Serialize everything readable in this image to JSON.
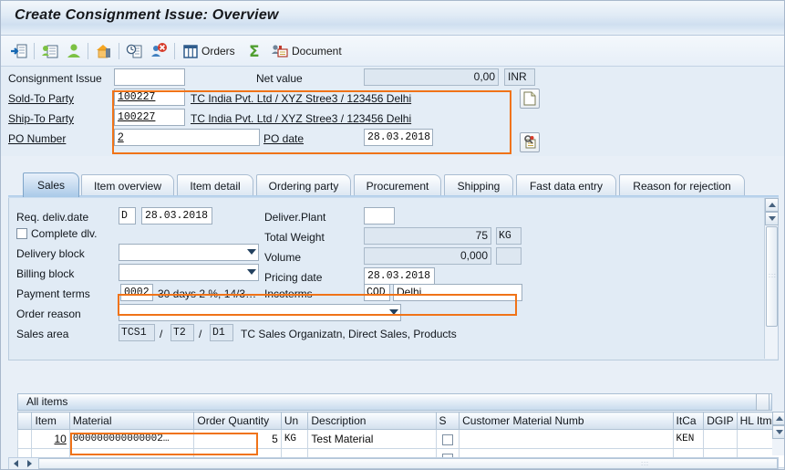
{
  "window": {
    "title": "Create Consignment Issue: Overview"
  },
  "toolbar": {
    "items": [
      {
        "name": "enter-icon",
        "label": ""
      },
      {
        "name": "create-with-reference-icon",
        "label": ""
      },
      {
        "name": "partner-icon",
        "label": ""
      },
      {
        "name": "sales-order-home-icon",
        "label": ""
      },
      {
        "name": "availability-check-icon",
        "label": ""
      },
      {
        "name": "reject-document-icon",
        "label": ""
      },
      {
        "name": "orders-icon",
        "label": "Orders"
      },
      {
        "name": "sum-icon",
        "label": ""
      },
      {
        "name": "document-icon",
        "label": "Document"
      }
    ],
    "orders_label": "Orders",
    "document_label": "Document"
  },
  "header": {
    "consignment_issue_label": "Consignment Issue",
    "consignment_issue_value": "",
    "net_value_label": "Net value",
    "net_value": "0,00",
    "currency": "INR",
    "sold_to_party_label": "Sold-To Party",
    "sold_to_party_value": "100227",
    "sold_to_party_desc": "TC India Pvt. Ltd / XYZ Stree3 / 123456 Delhi",
    "ship_to_party_label": "Ship-To Party",
    "ship_to_party_value": "100227",
    "ship_to_party_desc": "TC India Pvt. Ltd / XYZ Stree3 / 123456 Delhi",
    "po_number_label": "PO Number",
    "po_number_value": "2",
    "po_date_label": "PO date",
    "po_date_value": "28.03.2018"
  },
  "tabs": [
    {
      "label": "Sales",
      "active": true
    },
    {
      "label": "Item overview",
      "active": false
    },
    {
      "label": "Item detail",
      "active": false
    },
    {
      "label": "Ordering party",
      "active": false
    },
    {
      "label": "Procurement",
      "active": false
    },
    {
      "label": "Shipping",
      "active": false
    },
    {
      "label": "Fast data entry",
      "active": false
    },
    {
      "label": "Reason for rejection",
      "active": false
    }
  ],
  "sales": {
    "req_deliv_date_label": "Req. deliv.date",
    "req_deliv_date_type": "D",
    "req_deliv_date_value": "28.03.2018",
    "complete_dlv_label": "Complete dlv.",
    "complete_dlv_checked": false,
    "delivery_block_label": "Delivery block",
    "delivery_block_value": "",
    "billing_block_label": "Billing block",
    "billing_block_value": "",
    "payment_terms_label": "Payment terms",
    "payment_terms_code": "0002",
    "payment_terms_desc": "30 days 2 %, 14/3…",
    "order_reason_label": "Order reason",
    "order_reason_value": "",
    "sales_area_label": "Sales area",
    "sales_area_org": "TCS1",
    "sales_area_channel": "T2",
    "sales_area_division": "D1",
    "sales_area_desc": "TC Sales Organizatn, Direct Sales, Products",
    "deliver_plant_label": "Deliver.Plant",
    "deliver_plant_value": "",
    "total_weight_label": "Total Weight",
    "total_weight_value": "75",
    "total_weight_unit": "KG",
    "volume_label": "Volume",
    "volume_value": "0,000",
    "volume_unit": "",
    "pricing_date_label": "Pricing date",
    "pricing_date_value": "28.03.2018",
    "incoterms_label": "Incoterms",
    "incoterms_code": "COD",
    "incoterms_location": "Delhi",
    "sep_slash": "/"
  },
  "items": {
    "panel_title": "All items",
    "columns": [
      "Item",
      "Material",
      "Order Quantity",
      "Un",
      "Description",
      "S",
      "Customer Material Numb",
      "ItCa",
      "DGIP",
      "HL Itm"
    ],
    "rows": [
      {
        "item": "10",
        "material": "000000000000002…",
        "order_quantity": "5",
        "un": "KG",
        "description": "Test Material",
        "s": "",
        "customer_material_numb": "",
        "itca": "KEN",
        "dgip": "",
        "hl_itm": ""
      },
      {
        "item": "",
        "material": "",
        "order_quantity": "",
        "un": "",
        "description": "",
        "s": "",
        "customer_material_numb": "",
        "itca": "",
        "dgip": "",
        "hl_itm": ""
      }
    ]
  },
  "colors": {
    "highlight": "#f07318",
    "input_focus_bg": "#fdecc0",
    "panel_bg": "#e1ebf5",
    "readonly_bg": "#dde7f1"
  }
}
